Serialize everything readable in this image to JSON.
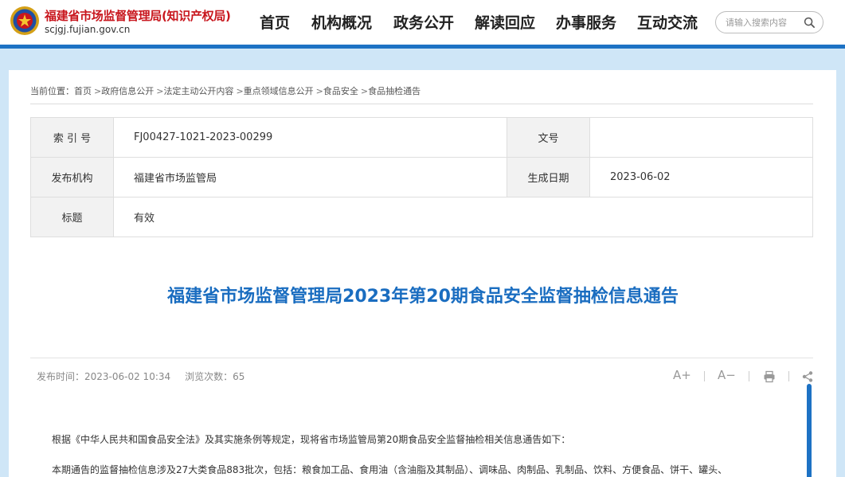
{
  "header": {
    "site_name": "福建省市场监督管理局(知识产权局)",
    "site_domain": "scjgj.fujian.gov.cn",
    "nav": [
      "首页",
      "机构概况",
      "政务公开",
      "解读回应",
      "办事服务",
      "互动交流"
    ],
    "search_placeholder": "请输入搜索内容",
    "accent_color": "#1d72c4",
    "brand_color": "#c8161d"
  },
  "breadcrumb": {
    "prefix": "当前位置：",
    "items": [
      "首页",
      "政府信息公开",
      "法定主动公开内容",
      "重点领域信息公开",
      "食品安全",
      "食品抽检通告"
    ],
    "separator": ">"
  },
  "info_table": {
    "index_label": "索 引 号",
    "index_value": "FJ00427-1021-2023-00299",
    "doc_no_label": "文号",
    "doc_no_value": "",
    "publisher_label": "发布机构",
    "publisher_value": "福建省市场监管局",
    "date_label": "生成日期",
    "date_value": "2023-06-02",
    "title_label": "标题",
    "title_value": "有效"
  },
  "article": {
    "title": "福建省市场监督管理局2023年第20期食品安全监督抽检信息通告",
    "publish_time": "发布时间：2023-06-02 10:34",
    "views": "浏览次数：65",
    "paragraphs": [
      "根据《中华人民共和国食品安全法》及其实施条例等规定，现将省市场监管局第20期食品安全监督抽检相关信息通告如下：",
      "本期通告的监督抽检信息涉及27大类食品883批次，包括：粮食加工品、食用油（含油脂及其制品）、调味品、肉制品、乳制品、饮料、方便食品、饼干、罐头、"
    ]
  },
  "tools": {
    "font_larger": "A+",
    "font_smaller": "A−"
  }
}
